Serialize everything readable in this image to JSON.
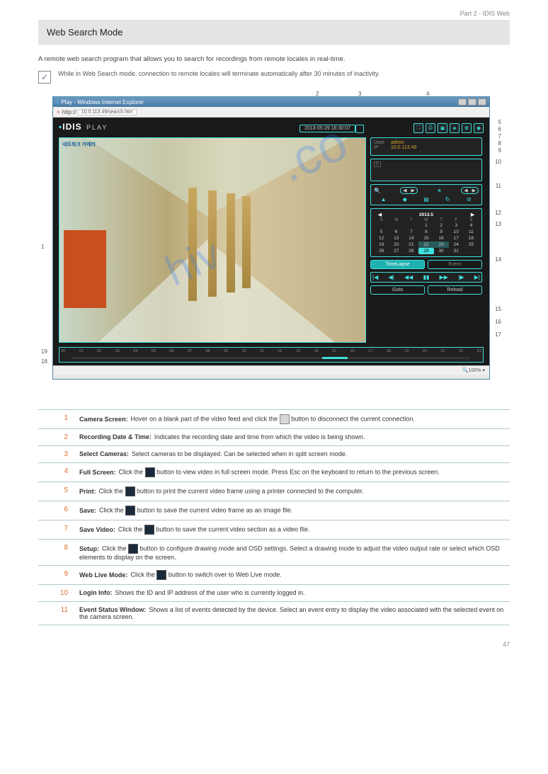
{
  "page_number": "47",
  "page_header_suffix": "Part 2 - IDIS Web",
  "section_title": "Web Search Mode",
  "intro": "A remote web search program that allows you to search for recordings from remote locales in real-time.",
  "note": "While in Web Search mode, connection to remote locales will terminate automatically after 30 minutes of inactivity.",
  "app": {
    "window_title": "Play - Windows Internet Explorer",
    "url_label": "http://",
    "url": "10.0.113.49/search.htm",
    "brand": "IDIS",
    "brand_sub": "PLAY",
    "datetime": "2013-05-29 16:30:07",
    "cam_title": "네트워크 카메라",
    "login": {
      "user_label": "User",
      "user": "admin",
      "ip_label": "IP",
      "ip": "10.0.113.49"
    },
    "calendar": {
      "title": "2013.5",
      "dow": [
        "S",
        "M",
        "T",
        "W",
        "T",
        "F",
        "S"
      ],
      "first_weekday": 3,
      "days_in_month": 31,
      "selected": 29,
      "today": 29,
      "highlighted": [
        22,
        23,
        29
      ]
    },
    "mode_tl": "TimeLapse",
    "mode_ev": "Event",
    "goto": "Goto",
    "reload": "Reload",
    "zoom_pct": "100%",
    "timeline_hours": [
      "00",
      "01",
      "02",
      "03",
      "04",
      "05",
      "06",
      "07",
      "08",
      "09",
      "10",
      "11",
      "12",
      "13",
      "14",
      "15",
      "16",
      "17",
      "18",
      "19",
      "20",
      "21",
      "22",
      "23"
    ]
  },
  "callouts": [
    "1",
    "2",
    "3",
    "4",
    "5",
    "6",
    "7",
    "8",
    "9",
    "10",
    "11",
    "12",
    "13",
    "14",
    "15",
    "16",
    "17",
    "18",
    "19"
  ],
  "rows": [
    {
      "n": "1",
      "label": "Camera Screen",
      "body": "Hover on a blank part of the video feed and click the       button to disconnect the current connection."
    },
    {
      "n": "2",
      "label": "Recording Date & Time",
      "body": "Indicates the recording date and time from which the video is being shown."
    },
    {
      "n": "3",
      "label": "Select Cameras",
      "body": "Select cameras to be displayed. Can be selected when in split screen mode."
    },
    {
      "n": "4",
      "label": "Full Screen",
      "body": "Click the       button to view video in full screen mode. Press Esc on the keyboard to return to the previous screen."
    },
    {
      "n": "5",
      "label": "Print",
      "body": "Click the       button to print the current video frame using a printer connected to the computer."
    },
    {
      "n": "6",
      "label": "Save",
      "body": "Click the       button to save the current video frame as an image file."
    },
    {
      "n": "7",
      "label": "Save Video",
      "body": "Click the       button to save the current video section as a video file."
    },
    {
      "n": "8",
      "label": "Setup",
      "body": "Click the       button to configure drawing mode and OSD settings. Select a drawing mode to adjust the video output rate or select which OSD elements to display on the screen."
    },
    {
      "n": "9",
      "label": "Web Live Mode",
      "body": "Click the       button to switch over to Web Live mode."
    },
    {
      "n": "10",
      "label": "Login Info",
      "body": "Shows the ID and IP address of the user who is currently logged in."
    },
    {
      "n": "11",
      "label": "Event Status Window",
      "body": "Shows a list of events detected by the device. Select an event entry to display the video associated with the selected event on the camera screen."
    }
  ]
}
